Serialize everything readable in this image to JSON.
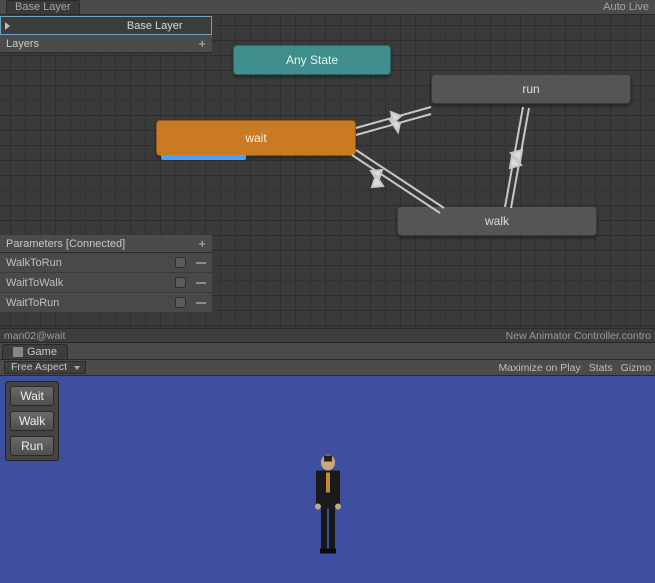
{
  "header": {
    "breadcrumb": "Base Layer",
    "autolive": "Auto Live"
  },
  "layers_panel": {
    "title": "Layers",
    "items": [
      {
        "label": "Base Layer"
      }
    ]
  },
  "graph": {
    "nodes": {
      "any_state": {
        "label": "Any State"
      },
      "wait": {
        "label": "wait"
      },
      "run": {
        "label": "run"
      },
      "walk": {
        "label": "walk"
      }
    }
  },
  "parameters_panel": {
    "title": "Parameters [Connected]",
    "items": [
      {
        "name": "WalkToRun"
      },
      {
        "name": "WaitToWalk"
      },
      {
        "name": "WaitToRun"
      }
    ]
  },
  "status": {
    "path": "man02@wait",
    "asset": "New Animator Controller.contro"
  },
  "game": {
    "tab": "Game",
    "aspect": "Free Aspect",
    "toolbar": {
      "maximize": "Maximize on Play",
      "stats": "Stats",
      "gizmos": "Gizmo"
    },
    "buttons": {
      "wait": "Wait",
      "walk": "Walk",
      "run": "Run"
    }
  }
}
